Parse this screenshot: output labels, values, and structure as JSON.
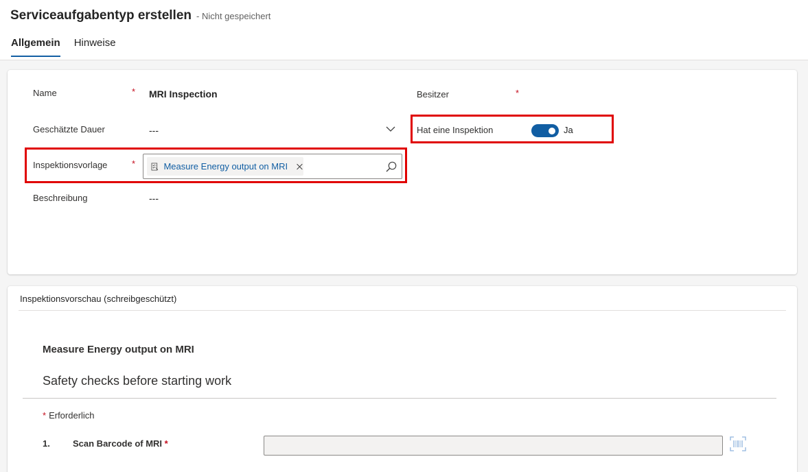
{
  "header": {
    "title": "Serviceaufgabentyp erstellen",
    "save_status": "- Nicht gespeichert",
    "tabs": [
      {
        "label": "Allgemein",
        "active": true
      },
      {
        "label": "Hinweise",
        "active": false
      }
    ]
  },
  "general": {
    "name": {
      "label": "Name",
      "required": "*",
      "value": "MRI Inspection"
    },
    "owner": {
      "label": "Besitzer",
      "required": "*",
      "value": ""
    },
    "duration": {
      "label": "Geschätzte Dauer",
      "value": "---",
      "icon": "chevron-down-icon"
    },
    "has_inspection": {
      "label": "Hat eine Inspektion",
      "value": "Ja",
      "on": true
    },
    "inspection_template": {
      "label": "Inspektionsvorlage",
      "required": "*",
      "value": "Measure Energy output on MRI",
      "icons": [
        "template-icon",
        "remove-icon",
        "search-icon"
      ]
    },
    "description": {
      "label": "Beschreibung",
      "value": "---"
    }
  },
  "preview": {
    "title": "Inspektionsvorschau (schreibgeschützt)",
    "inspection_name": "Measure Energy output on MRI",
    "section_title": "Safety checks before starting work",
    "required_star": "*",
    "required_note": "Erforderlich",
    "questions": [
      {
        "number": "1.",
        "text": "Scan Barcode of MRI",
        "required": "*",
        "value": "",
        "icon": "barcode-scan-icon"
      }
    ]
  },
  "colors": {
    "accent": "#115ea3",
    "required": "#c50f1f",
    "highlight_box": "#e00000"
  }
}
